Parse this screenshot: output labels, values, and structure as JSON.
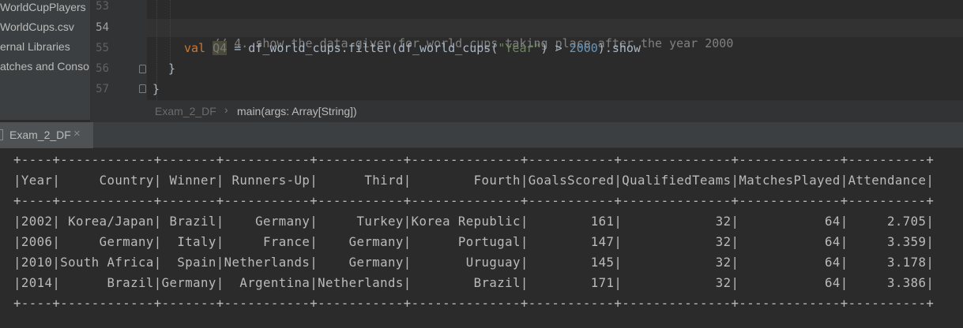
{
  "project_tree": [
    "WorldCupPlayers",
    "WorldCups.csv",
    "ernal Libraries",
    "atches and Conso"
  ],
  "line_numbers": [
    "53",
    "54",
    "55",
    "56",
    "57"
  ],
  "code": {
    "comment": "// 4. show the data given for world cups taking place after the year 2000",
    "val_kw": "val",
    "var_name": "Q4",
    "assign": " = df_world_cups.filter(df_world_cups(",
    "string_arg": "\"Year\"",
    "compare": ") > ",
    "number": "2000",
    "tail": ").show",
    "close_inner": "}",
    "close_outer": "}"
  },
  "breadcrumb": {
    "object": "Exam_2_DF",
    "separator": "›",
    "method": "main(args: Array[String])"
  },
  "run_tab": {
    "label": "Exam_2_DF",
    "close": "×"
  },
  "console_lines": [
    "+----+------------+-------+-----------+-----------+--------------+-----------+--------------+-------------+----------+",
    "|Year|     Country| Winner| Runners-Up|      Third|        Fourth|GoalsScored|QualifiedTeams|MatchesPlayed|Attendance|",
    "+----+------------+-------+-----------+-----------+--------------+-----------+--------------+-------------+----------+",
    "|2002| Korea/Japan| Brazil|    Germany|     Turkey|Korea Republic|        161|            32|           64|     2.705|",
    "|2006|     Germany|  Italy|     France|    Germany|      Portugal|        147|            32|           64|     3.359|",
    "|2010|South Africa|  Spain|Netherlands|    Germany|       Uruguay|        145|            32|           64|     3.178|",
    "|2014|      Brazil|Germany|  Argentina|Netherlands|        Brazil|        171|            32|           64|     3.386|",
    "+----+------------+-------+-----------+-----------+--------------+-----------+--------------+-------------+----------+"
  ]
}
